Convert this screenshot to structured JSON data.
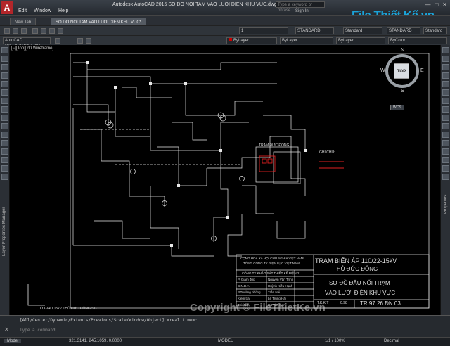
{
  "app": {
    "logo": "A",
    "title": "Autodesk AutoCAD 2015    SO DO NOI TAM VAO LUOI DIEN KHU VUC.dwg",
    "menu": [
      "Edit",
      "Window",
      "Help"
    ],
    "search_placeholder": "Type a keyword or phrase",
    "sign_in": "Sign In"
  },
  "watermark": {
    "brand": "File Thiết Kế.vn",
    "footer": "Copyright © FileThietKe.vn"
  },
  "tabs": [
    "New Tab",
    "SO DO NOI TAM VAO LUOI DIEN KHU VUC*"
  ],
  "ribbon": {
    "layer_value": "1",
    "text_style": "STANDARD",
    "dim_style": "Standard",
    "table_style": "STANDARD",
    "mleader_style": "Standard",
    "workspace": "AutoCAD Cla...AutoCAD 201",
    "color": "ByLayer",
    "linetype": "ByLayer",
    "lineweight": "ByLayer",
    "plot_style": "ByColor"
  },
  "viewport": {
    "label": "[−][Top][2D Wireframe]",
    "compass": {
      "n": "N",
      "s": "S",
      "e": "E",
      "w": "W",
      "face": "TOP"
    },
    "wcs": "WCS"
  },
  "side_palettes": {
    "left": "Layer Properties Manager",
    "right": "Properties"
  },
  "drawing": {
    "title_block": {
      "org_lines": [
        "CỘNG HOÀ XÃ HỘI CHỦ NGHĨA VIỆT NAM",
        "TỔNG CÔNG TY ĐIỆN LỰC VIỆT NAM",
        "CÔNG TY KHẢO SÁT THIẾT KẾ ĐIỆN 2"
      ],
      "project_title": "TRẠM BIẾN ÁP 110/22-15kV",
      "project_subtitle": "THỦ ĐỨC ĐÔNG",
      "drawing_title_1": "SƠ ĐỒ ĐẤU NỐI TRẠM",
      "drawing_title_2": "VÀO LƯỚI ĐIỆN KHU VỰC",
      "rows": [
        {
          "role": "P. Giám đốc",
          "name": "Nguyễn Văn Trình"
        },
        {
          "role": "C.N.Đ.A",
          "name": "Huỳnh Kiều Hạnh"
        },
        {
          "role": "P.Trưởng phòng",
          "name": "Trần Hải"
        },
        {
          "role": "Kiểm tra",
          "name": "Lê Trung Hải"
        },
        {
          "role": "Thiết kế",
          "name": "Hà Văn Sơn"
        },
        {
          "role": "Kiểm soát",
          "name": "Lê Trung Hải"
        }
      ],
      "tkkt_label": "T.K.K.T",
      "tkkt_value": "0.98",
      "drawing_number": "TR.97.26.ĐN.03"
    },
    "notes_title": "GHI CHÚ:",
    "substation_label": "TRẠM ĐỨC ĐÔNG",
    "bottom_left_label": "TỜ GIAO 15kV THỦ ĐỨC ĐÔNG SG"
  },
  "command_line": {
    "history": "[All/Center/Dynamic/Extents/Previous/Scale/Window/Object] <real time>:",
    "prompt_placeholder": "Type a command"
  },
  "status_bar": {
    "model_tab": "Model",
    "coords": "321.3141, 245.1059, 0.0000",
    "model_label": "MODEL",
    "scale": "1/1 / 100%",
    "units": "Decimal"
  }
}
